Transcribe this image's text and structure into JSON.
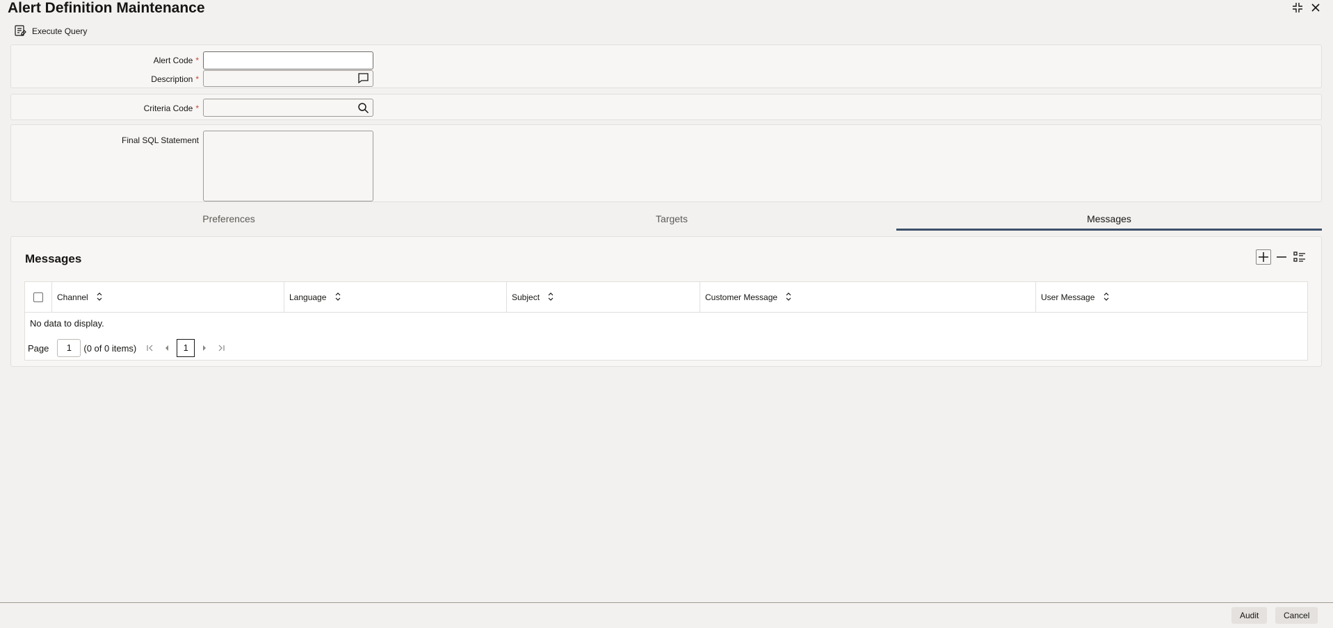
{
  "window": {
    "title": "Alert Definition Maintenance"
  },
  "toolbar": {
    "execute_query_label": "Execute Query"
  },
  "form": {
    "alert_code": {
      "label": "Alert Code",
      "value": ""
    },
    "description": {
      "label": "Description",
      "value": ""
    },
    "criteria_code": {
      "label": "Criteria Code",
      "value": ""
    },
    "final_sql": {
      "label": "Final SQL Statement",
      "value": ""
    },
    "required_mark": "*"
  },
  "tabs": [
    {
      "label": "Preferences"
    },
    {
      "label": "Targets"
    },
    {
      "label": "Messages",
      "active": true
    }
  ],
  "messages": {
    "title": "Messages",
    "columns": [
      "Channel",
      "Language",
      "Subject",
      "Customer Message",
      "User Message"
    ],
    "empty_text": "No data to display.",
    "pager": {
      "page_label": "Page",
      "page_value": "1",
      "count_text": "(0 of 0 items)",
      "current_page": "1"
    }
  },
  "footer": {
    "audit_label": "Audit",
    "cancel_label": "Cancel"
  },
  "colors": {
    "accent": "#3c4f6b",
    "required": "#c74634"
  }
}
